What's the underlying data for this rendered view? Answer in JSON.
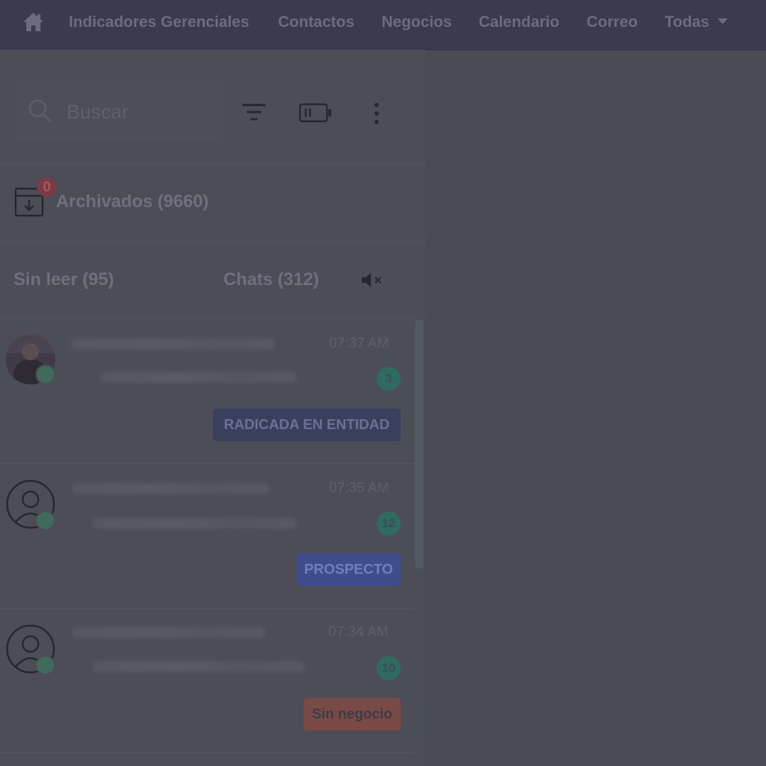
{
  "nav": {
    "home_icon": "home-icon",
    "items": [
      {
        "label": "Indicadores Gerenciales"
      },
      {
        "label": "Contactos"
      },
      {
        "label": "Negocios"
      },
      {
        "label": "Calendario"
      },
      {
        "label": "Correo"
      },
      {
        "label": "Todas"
      }
    ]
  },
  "search": {
    "placeholder": "Buscar",
    "value": ""
  },
  "toolbar": {
    "icons": [
      "filter-icon",
      "battery-icon",
      "more-vertical-icon"
    ]
  },
  "archived": {
    "badge": "0",
    "label": "Archivados (9660)"
  },
  "tabs": {
    "unread": "Sin leer (95)",
    "chats": "Chats (312)",
    "mute_icon": "mute-icon"
  },
  "chats": [
    {
      "time": "07:37 AM",
      "count": "3",
      "tag": "RADICADA EN ENTIDAD",
      "tag_bg": "#3a3f5e",
      "tag_fg": "#6c7193"
    },
    {
      "time": "07:35 AM",
      "count": "12",
      "tag": "PROSPECTO",
      "tag_bg": "#3f4d8c",
      "tag_fg": "#6d7fc0"
    },
    {
      "time": "07:34 AM",
      "count": "10",
      "tag": "Sin negocio",
      "tag_bg": "#7a4a47",
      "tag_fg": "#3e3b45"
    }
  ],
  "colors": {
    "background": "#4a4b55",
    "topbar": "#3a3c4c",
    "accent_green": "#2f6a63"
  }
}
